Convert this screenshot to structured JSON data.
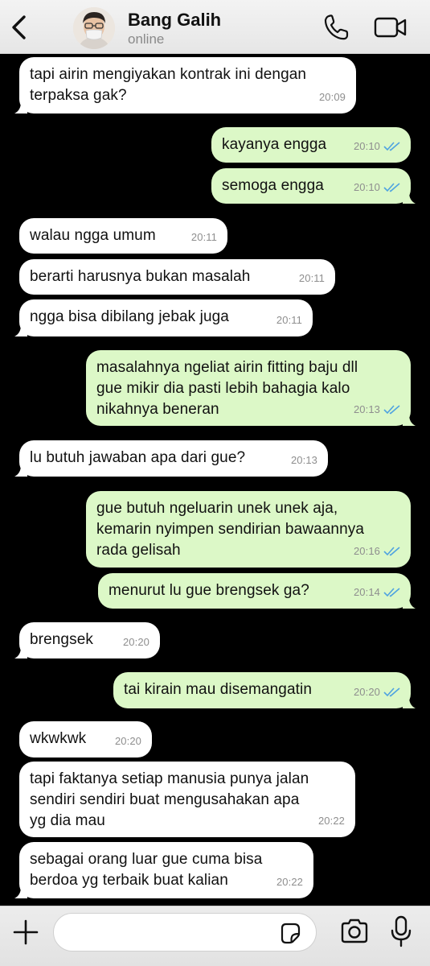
{
  "header": {
    "name": "Bang Galih",
    "status": "online"
  },
  "messages": [
    {
      "dir": "in",
      "text": "tapi airin mengiyakan kontrak ini dengan\nterpaksa gak?",
      "time": "20:09",
      "tail": true
    },
    {
      "dir": "out",
      "text": "kayanya engga",
      "time": "20:10",
      "read": true,
      "tail": false
    },
    {
      "dir": "out",
      "text": "semoga engga",
      "time": "20:10",
      "read": true,
      "tail": true
    },
    {
      "dir": "in",
      "text": "walau ngga umum",
      "time": "20:11",
      "tail": false
    },
    {
      "dir": "in",
      "text": "berarti harusnya bukan masalah",
      "time": "20:11",
      "tail": false
    },
    {
      "dir": "in",
      "text": "ngga bisa dibilang jebak juga",
      "time": "20:11",
      "tail": true
    },
    {
      "dir": "out",
      "text": "masalahnya ngeliat airin fitting baju dll\ngue mikir dia pasti lebih bahagia kalo\nnikahnya beneran",
      "time": "20:13",
      "read": true,
      "tail": true
    },
    {
      "dir": "in",
      "text": "lu butuh jawaban apa dari gue?",
      "time": "20:13",
      "tail": true
    },
    {
      "dir": "out",
      "text": "gue butuh ngeluarin unek unek aja,\nkemarin nyimpen sendirian bawaannya\nrada gelisah",
      "time": "20:16",
      "read": true,
      "tail": false
    },
    {
      "dir": "out",
      "text": "menurut lu gue brengsek ga?",
      "time": "20:14",
      "read": true,
      "tail": true
    },
    {
      "dir": "in",
      "text": "brengsek",
      "time": "20:20",
      "tail": true
    },
    {
      "dir": "out",
      "text": "tai kirain mau disemangatin",
      "time": "20:20",
      "read": true,
      "tail": true
    },
    {
      "dir": "in",
      "text": "wkwkwk",
      "time": "20:20",
      "tail": false
    },
    {
      "dir": "in",
      "text": "tapi faktanya setiap manusia punya jalan\nsendiri sendiri buat mengusahakan apa\nyg dia mau",
      "time": "20:22",
      "tail": false
    },
    {
      "dir": "in",
      "text": "sebagai orang luar gue cuma bisa\nberdoa yg terbaik buat kalian",
      "time": "20:22",
      "tail": true
    }
  ],
  "input": {
    "value": "",
    "placeholder": ""
  },
  "colors": {
    "incoming": "#ffffff",
    "outgoing": "#dcf8c7",
    "read_ticks": "#4fa3e0",
    "background": "#000000"
  },
  "icons": [
    "back-chevron-icon",
    "phone-icon",
    "video-camera-icon",
    "plus-icon",
    "sticker-icon",
    "camera-icon",
    "microphone-icon"
  ]
}
